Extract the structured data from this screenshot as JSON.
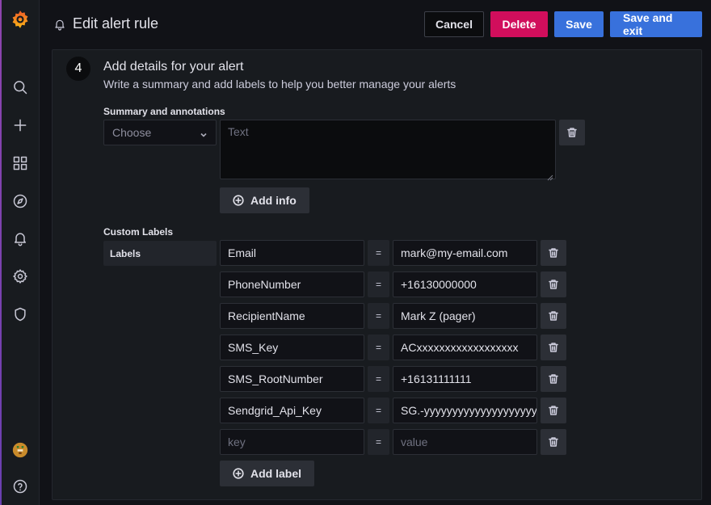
{
  "header": {
    "title": "Edit alert rule",
    "cancel_label": "Cancel",
    "delete_label": "Delete",
    "save_label": "Save",
    "save_exit_label": "Save and exit"
  },
  "sidebar": {
    "items": [
      "grafana-logo-icon",
      "search-icon",
      "plus-icon",
      "dashboards-icon",
      "explore-icon",
      "alerting-icon",
      "settings-icon",
      "shield-icon",
      "avatar",
      "help-icon"
    ]
  },
  "step": {
    "number": "4",
    "title": "Add details for your alert",
    "description": "Write a summary and add labels to help you better manage your alerts"
  },
  "summary": {
    "section_label": "Summary and annotations",
    "select_placeholder": "Choose",
    "text_placeholder": "Text",
    "add_info_label": "Add info"
  },
  "labels": {
    "section_label": "Custom Labels",
    "box_label": "Labels",
    "equals": "=",
    "rows": [
      {
        "key": "Email",
        "value": "mark@my-email.com"
      },
      {
        "key": "PhoneNumber",
        "value": "+16130000000"
      },
      {
        "key": "RecipientName",
        "value": "Mark Z (pager)"
      },
      {
        "key": "SMS_Key",
        "value": "ACxxxxxxxxxxxxxxxxxx"
      },
      {
        "key": "SMS_RootNumber",
        "value": "+16131111111"
      },
      {
        "key": "Sendgrid_Api_Key",
        "value": "SG.-yyyyyyyyyyyyyyyyyyyy"
      }
    ],
    "empty_key_placeholder": "key",
    "empty_value_placeholder": "value",
    "add_label_label": "Add label"
  },
  "colors": {
    "primary": "#3871dc",
    "danger": "#d10e5c",
    "background": "#111217",
    "panel": "#181b1f"
  }
}
